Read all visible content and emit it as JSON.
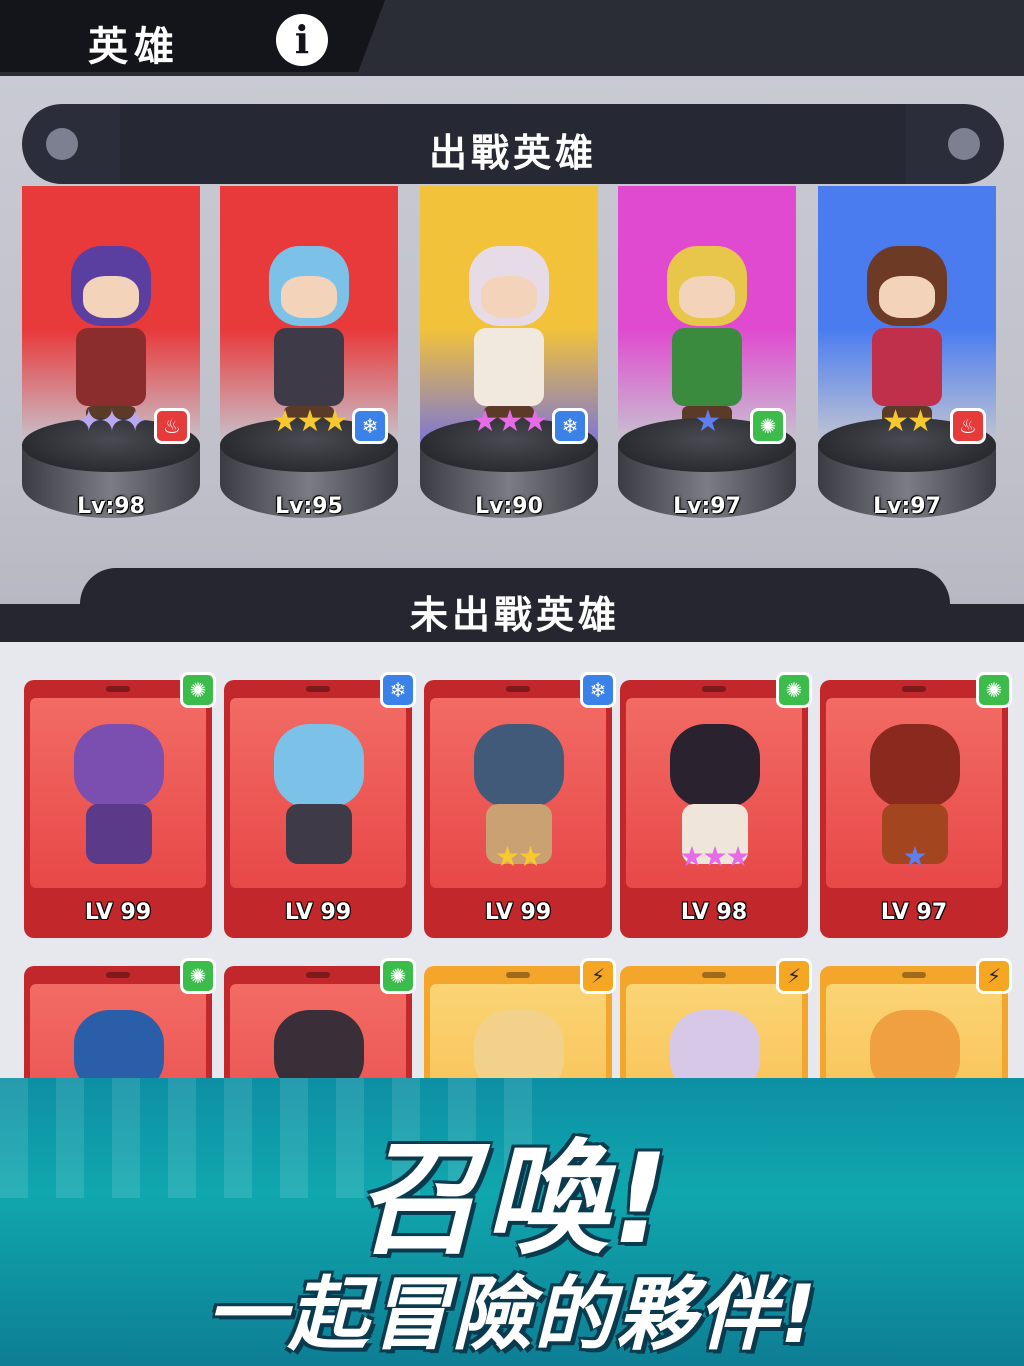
{
  "header": {
    "title": "英雄",
    "info_icon": "info-icon"
  },
  "deployed": {
    "title": "出戰英雄",
    "heroes": [
      {
        "level": "Lv:98",
        "stars": "✦✦✦",
        "star_color": "#b9a8f0",
        "element": "fire",
        "element_glyph": "♨",
        "bg_top": "#e8393b",
        "bg_bottom": "#c6c7d0",
        "hair": "#5a3fa0",
        "outfit": "#8b2d2d"
      },
      {
        "level": "Lv:95",
        "stars": "★★★",
        "star_color": "#f7c830",
        "element": "ice",
        "element_glyph": "❄",
        "bg_top": "#e8393b",
        "bg_bottom": "#c6c7d0",
        "hair": "#7cc2e8",
        "outfit": "#3e3a48"
      },
      {
        "level": "Lv:90",
        "stars": "★★★",
        "star_color": "#e66be6",
        "element": "ice",
        "element_glyph": "❄",
        "bg_top": "#f2c23a",
        "bg_bottom": "#7a74d8",
        "hair": "#e8dbe8",
        "outfit": "#f1e9de"
      },
      {
        "level": "Lv:97",
        "stars": "★",
        "star_color": "#5f7ef0",
        "element": "wind",
        "element_glyph": "✺",
        "bg_top": "#e04ad0",
        "bg_bottom": "#c6c7d0",
        "hair": "#e7c64a",
        "outfit": "#3b8b3e"
      },
      {
        "level": "Lv:97",
        "stars": "★★",
        "star_color": "#f7c830",
        "element": "fire",
        "element_glyph": "♨",
        "bg_top": "#4a7cf0",
        "bg_bottom": "#c6c7d0",
        "hair": "#6d3a26",
        "outfit": "#c0304a"
      }
    ]
  },
  "reserve": {
    "title": "未出戰英雄",
    "cards": [
      {
        "level": "LV 99",
        "stars": "",
        "star_color": "#4fd6f0",
        "element": "wind",
        "element_glyph": "✺",
        "tier": "red",
        "head": "#7a4fb0",
        "body": "#5b3a8a"
      },
      {
        "level": "LV 99",
        "stars": "",
        "star_color": "#4fd6f0",
        "element": "ice",
        "element_glyph": "❄",
        "tier": "red",
        "head": "#7cc2e8",
        "body": "#3e3a48"
      },
      {
        "level": "LV 99",
        "stars": "★★",
        "star_color": "#f7c830",
        "element": "ice",
        "element_glyph": "❄",
        "tier": "red",
        "head": "#415a7a",
        "body": "#c9a173"
      },
      {
        "level": "LV 98",
        "stars": "★★★",
        "star_color": "#e66be6",
        "element": "wind",
        "element_glyph": "✺",
        "tier": "red",
        "head": "#2b2230",
        "body": "#efe5da"
      },
      {
        "level": "LV 97",
        "stars": "★",
        "star_color": "#5f7ef0",
        "element": "wind",
        "element_glyph": "✺",
        "tier": "red",
        "head": "#8a2a1e",
        "body": "#a3461f"
      },
      {
        "level": "",
        "stars": "",
        "star_color": "#f7c830",
        "element": "wind",
        "element_glyph": "✺",
        "tier": "red",
        "head": "#2b5ea8",
        "body": "#d8c23a"
      },
      {
        "level": "",
        "stars": "",
        "star_color": "#f7c830",
        "element": "wind",
        "element_glyph": "✺",
        "tier": "red",
        "head": "#3a2f38",
        "body": "#8b6b8a"
      },
      {
        "level": "",
        "stars": "",
        "star_color": "#f7c830",
        "element": "bolt",
        "element_glyph": "⚡",
        "tier": "orange",
        "head": "#f2d28a",
        "body": "#6ec8e8"
      },
      {
        "level": "",
        "stars": "",
        "star_color": "#f7c830",
        "element": "bolt",
        "element_glyph": "⚡",
        "tier": "orange",
        "head": "#d8c8e8",
        "body": "#a8d8f0"
      },
      {
        "level": "",
        "stars": "",
        "star_color": "#f7c830",
        "element": "bolt",
        "element_glyph": "⚡",
        "tier": "orange",
        "head": "#f0a040",
        "body": "#e8c060"
      }
    ]
  },
  "promo": {
    "headline": "召喚!",
    "subline": "一起冒險的夥伴!"
  }
}
